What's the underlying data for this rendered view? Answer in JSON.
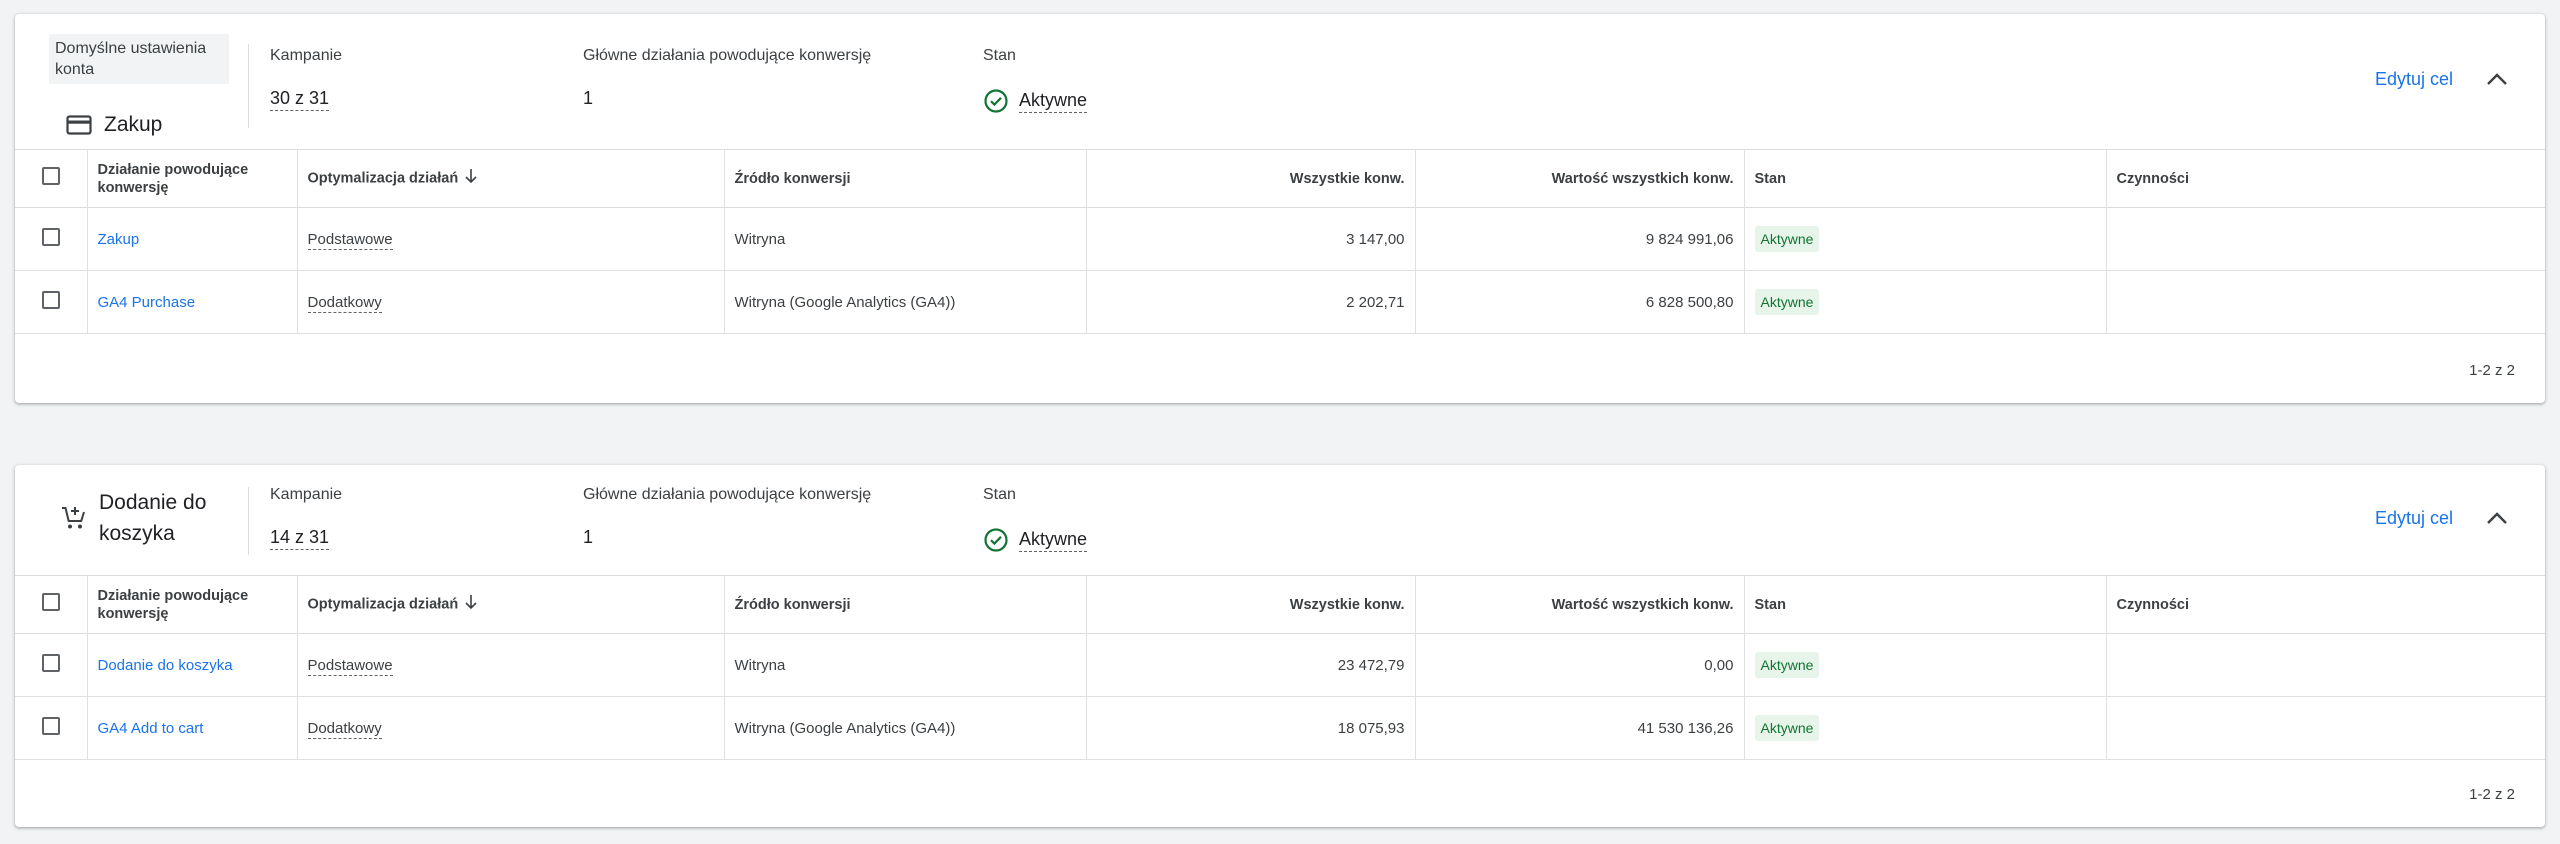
{
  "colors": {
    "accent": "#1a73e8",
    "status_green": "#137333",
    "badge_bg": "#e6f4ea"
  },
  "table_headers": {
    "action": "Działanie powodujące konwersję",
    "optimization": "Optymalizacja działań",
    "source": "Źródło konwersji",
    "all_conv": "Wszystkie konw.",
    "all_conv_value": "Wartość wszystkich konw.",
    "status": "Stan",
    "actions": "Czynności"
  },
  "goals": [
    {
      "default_badge": "Domyślne ustawienia konta",
      "icon": "credit-card-icon",
      "title": "Zakup",
      "campaigns_label": "Kampanie",
      "campaigns_value": "30 z 31",
      "primary_actions_label": "Główne działania powodujące konwersję",
      "primary_actions_value": "1",
      "status_label": "Stan",
      "status_value": "Aktywne",
      "edit_label": "Edytuj cel",
      "rows": [
        {
          "action": "Zakup",
          "optimization": "Podstawowe",
          "source": "Witryna",
          "all_conv": "3 147,00",
          "all_conv_value": "9 824 991,06",
          "status": "Aktywne"
        },
        {
          "action": "GA4 Purchase",
          "optimization": "Dodatkowy",
          "source": "Witryna (Google Analytics (GA4))",
          "all_conv": "2 202,71",
          "all_conv_value": "6 828 500,80",
          "status": "Aktywne"
        }
      ],
      "pagination": "1-2 z 2"
    },
    {
      "icon": "add-shopping-cart-icon",
      "title": "Dodanie do koszyka",
      "campaigns_label": "Kampanie",
      "campaigns_value": "14 z 31",
      "primary_actions_label": "Główne działania powodujące konwersję",
      "primary_actions_value": "1",
      "status_label": "Stan",
      "status_value": "Aktywne",
      "edit_label": "Edytuj cel",
      "rows": [
        {
          "action": "Dodanie do koszyka",
          "optimization": "Podstawowe",
          "source": "Witryna",
          "all_conv": "23 472,79",
          "all_conv_value": "0,00",
          "status": "Aktywne"
        },
        {
          "action": "GA4 Add to cart",
          "optimization": "Dodatkowy",
          "source": "Witryna (Google Analytics (GA4))",
          "all_conv": "18 075,93",
          "all_conv_value": "41 530 136,26",
          "status": "Aktywne"
        }
      ],
      "pagination": "1-2 z 2"
    }
  ]
}
